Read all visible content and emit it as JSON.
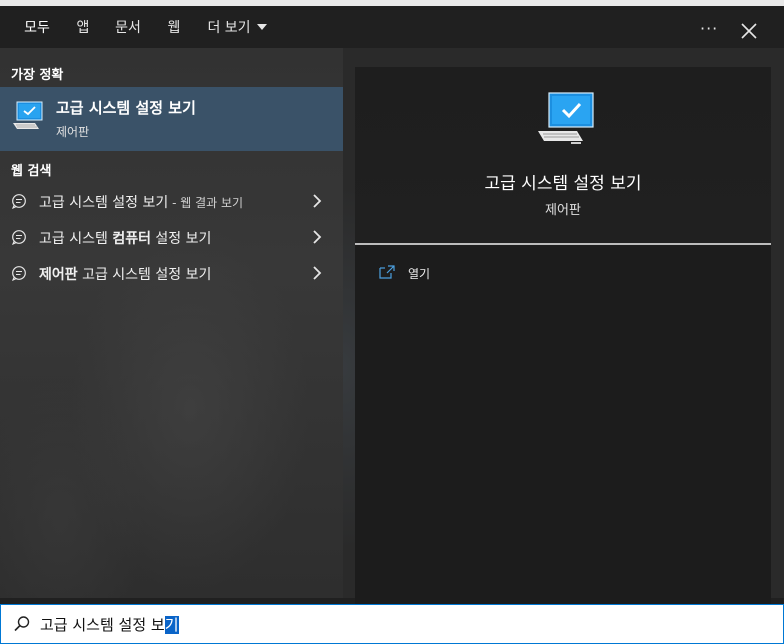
{
  "tabs": [
    {
      "label": "모두",
      "active": true
    },
    {
      "label": "앱"
    },
    {
      "label": "문서"
    },
    {
      "label": "웹"
    },
    {
      "label": "더 보기"
    }
  ],
  "toolbar": {
    "more_icon": "more-icon",
    "close_icon": "close-icon"
  },
  "best_match": {
    "header": "가장 정확",
    "title": "고급 시스템 설정 보기",
    "subtitle": "제어판",
    "icon": "computer-monitor-check-icon"
  },
  "web_search": {
    "header": "웹 검색",
    "items": [
      {
        "text": "고급 시스템 설정 보기",
        "hint": " - 웹 결과 보기"
      },
      {
        "text_prefix": "고급 시스템 ",
        "text_bold": "컴퓨터",
        "text_suffix": " 설정 보기"
      },
      {
        "text_bold": "제어판",
        "text_suffix": " 고급 시스템 설정 보기"
      }
    ]
  },
  "preview": {
    "title": "고급 시스템 설정 보기",
    "subtitle": "제어판",
    "actions": [
      {
        "label": "열기",
        "icon": "open-external-icon"
      }
    ]
  },
  "search": {
    "value_unselected": "고급 시스템 설정 보",
    "value_selected": "기",
    "icon": "search-icon"
  },
  "colors": {
    "accent": "#4ca0e0",
    "selection": "#3a5268",
    "search_border": "#0078d4"
  }
}
